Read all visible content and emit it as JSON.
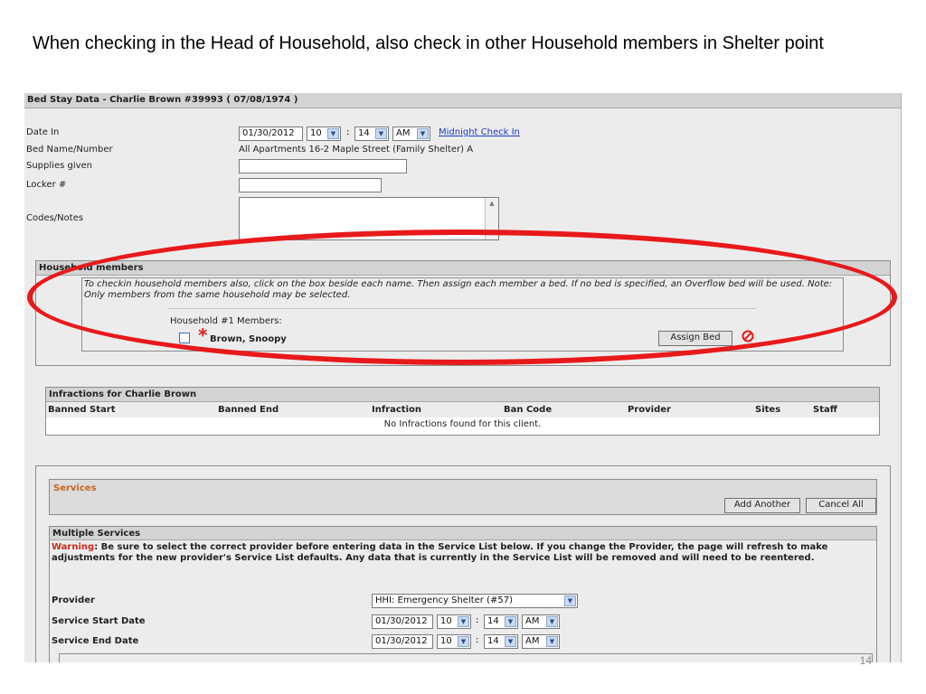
{
  "slide": {
    "title": "When checking in the Head of Household, also check in other Household members in Shelter point",
    "page_number": "14"
  },
  "bed_stay": {
    "header": "Bed Stay Data - Charlie Brown #39993 ( 07/08/1974 )",
    "date_in_label": "Date In",
    "date_in_value": "01/30/2012",
    "hour": "10",
    "colon": ":",
    "minute": "14",
    "ampm": "AM",
    "midnight_link": "Midnight Check In",
    "bed_label": "Bed Name/Number",
    "bed_value": "All Apartments 16-2 Maple Street (Family Shelter) A",
    "supplies_label": "Supplies given",
    "locker_label": "Locker #",
    "codes_label": "Codes/Notes"
  },
  "household": {
    "header": "Household members",
    "instructions": "To checkin household members also, click on the box beside each name. Then assign each member a bed. If no bed is specified, an Overflow bed will be used. Note: Only members from the same household may be selected.",
    "group_label": "Household #1 Members:",
    "member_name": "Brown, Snoopy",
    "assign_button": "Assign Bed"
  },
  "infractions": {
    "header": "Infractions for Charlie Brown",
    "columns": [
      "Banned Start",
      "Banned End",
      "Infraction",
      "Ban Code",
      "Provider",
      "Sites",
      "Staff"
    ],
    "empty_message": "No Infractions found for this client."
  },
  "services": {
    "header": "Services",
    "add_another": "Add Another",
    "cancel_all": "Cancel All",
    "multiple_header": "Multiple Services",
    "warning_label": "Warning",
    "warning_text": ": Be sure to select the correct provider before entering data in the Service List below. If you change the Provider, the page will refresh to make adjustments for the new provider's Service List defaults. Any data that is currently in the Service List will be removed and will need to be reentered.",
    "provider_label": "Provider",
    "provider_value": "HHI: Emergency Shelter (#57)",
    "start_label": "Service Start Date",
    "start_date": "01/30/2012",
    "start_hour": "10",
    "start_minute": "14",
    "start_ampm": "AM",
    "end_label": "Service End Date",
    "end_date": "01/30/2012",
    "end_hour": "10",
    "end_minute": "14",
    "end_ampm": "AM"
  },
  "colors": {
    "highlight": "#e8191b",
    "warning": "#cc2a1a",
    "services_title": "#c8641e",
    "link": "#1a3dbf"
  }
}
